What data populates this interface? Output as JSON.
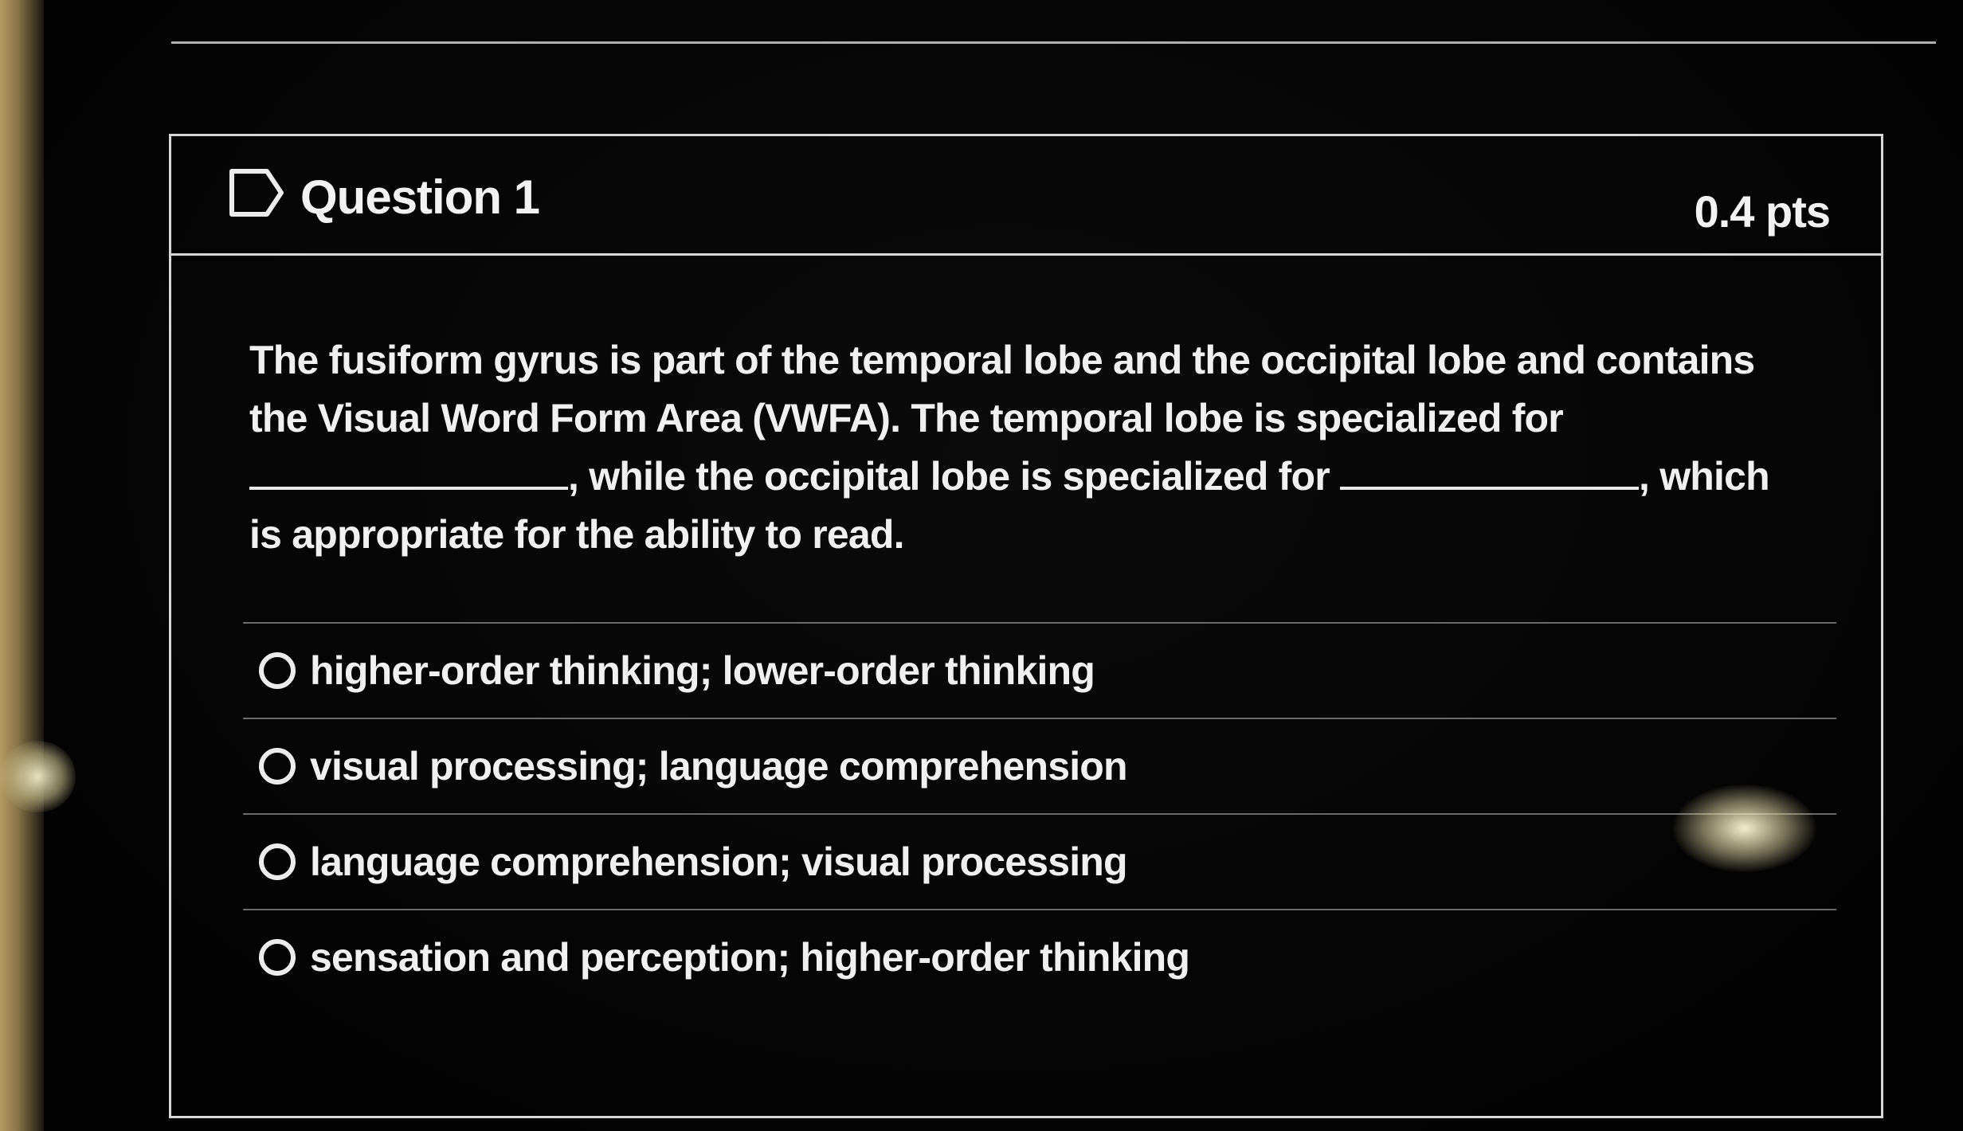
{
  "question": {
    "title": "Question 1",
    "points": "0.4 pts",
    "flag_icon": "flag-outline-icon",
    "text_part1": "The fusiform gyrus is part of the temporal lobe and the occipital lobe and contains the Visual Word Form Area (VWFA). The temporal lobe is specialized for",
    "text_part2": "while the occipital lobe is specialized for",
    "text_part3": ", which is appropriate for the ability to read."
  },
  "answers": [
    {
      "label": "higher-order thinking; lower-order thinking",
      "selected": false
    },
    {
      "label": "visual processing; language comprehension",
      "selected": false
    },
    {
      "label": "language comprehension; visual processing",
      "selected": false
    },
    {
      "label": "sensation and perception; higher-order thinking",
      "selected": false
    }
  ]
}
